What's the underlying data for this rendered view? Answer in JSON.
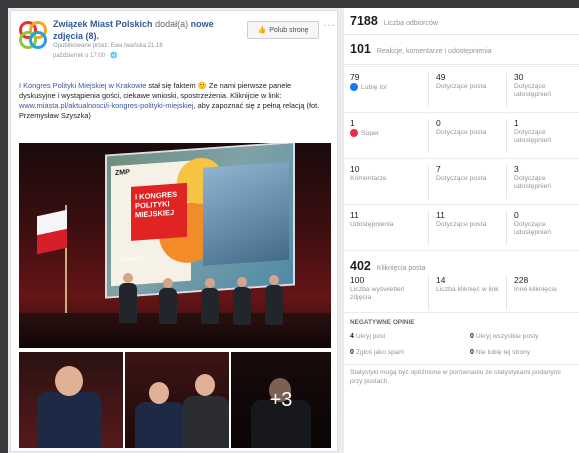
{
  "post": {
    "page_name": "Związek Miast Polskich",
    "action_text": "dodał(a)",
    "action_strong": "nowe",
    "action_line2": "zdjęcia (8).",
    "published_by": "Opublikowane przez: Ewa Iwańska 21.18",
    "date": "październik o 17:00 · ",
    "like_page_label": "Polub stronę",
    "more_label": "···",
    "text_link1": "I Kongres Polityki Miejskiej w Krakowie",
    "text_body1": " stał się faktem 🙂 Ze nami pierwsze panele dyskusyjne i wystąpienia gości, ciekawe wnioski, spostrzeżenia. Kliknijcie w link: ",
    "text_link2": "www.miasta.pl/aktualnosci/i-kongres-polityki-miejskiej",
    "text_body2": ", aby zapoznać się z pełną relacją (fot. Przemysław Szyszka)",
    "slide_brand": "ZMP",
    "slide_badge": "I KONGRES POLITYKI MIEJSKIEJ",
    "slide_tag": "KRAKÓW",
    "more_photos": "+3"
  },
  "insights": {
    "reach_value": "7188",
    "reach_label": "Liczba odbiorców",
    "engagement_value": "101",
    "engagement_label": "Reakcje, komentarze i udostępnienia",
    "rows": [
      {
        "icon": "like-icon",
        "value": "79",
        "label": "Lubię to!",
        "c2_value": "49",
        "c2_label": "Dotyczące posta",
        "c3_value": "30",
        "c3_label": "Dotyczące udostępnień"
      },
      {
        "icon": "wow-icon",
        "value": "1",
        "label": "Super",
        "c2_value": "0",
        "c2_label": "Dotyczące posta",
        "c3_value": "1",
        "c3_label": "Dotyczące udostępnień"
      },
      {
        "icon": "",
        "value": "10",
        "label": "Komentarze",
        "c2_value": "7",
        "c2_label": "Dotyczące posta",
        "c3_value": "3",
        "c3_label": "Dotyczące udostępnień"
      },
      {
        "icon": "",
        "value": "11",
        "label": "Udostępnienia",
        "c2_value": "11",
        "c2_label": "Dotyczące posta",
        "c3_value": "0",
        "c3_label": "Dotyczące udostępnień"
      }
    ],
    "clicks_value": "402",
    "clicks_label": "Kliknięcia posta",
    "clicks": [
      {
        "value": "100",
        "label": "Liczba wyświetleń zdjęcia"
      },
      {
        "value": "14",
        "label": "Liczba kliknięć w link"
      },
      {
        "value": "228",
        "label": "Inne kliknięcia"
      }
    ],
    "negative_title": "NEGATYWNE OPINIE",
    "negative": [
      {
        "value": "4",
        "label": "Ukryj post"
      },
      {
        "value": "0",
        "label": "Ukryj wszystkie posty"
      },
      {
        "value": "0",
        "label": "Zgłoś jako spam"
      },
      {
        "value": "0",
        "label": "Nie lubię tej strony"
      }
    ],
    "footnote": "Statystyki mogą być opóźnione w porównaniu ze statystykami podanymi przy postach."
  },
  "colors": {
    "link": "#365899",
    "like_blue": "#1877f2",
    "wow_red": "#f0284a"
  }
}
